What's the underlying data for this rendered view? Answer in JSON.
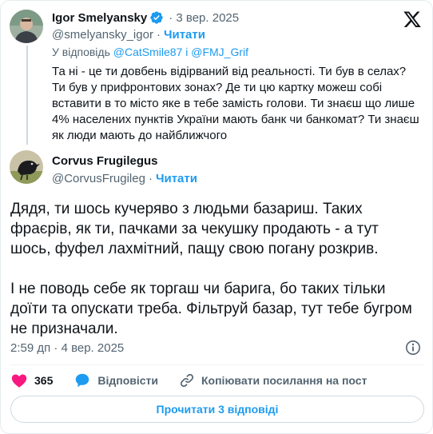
{
  "quoted": {
    "name": "Igor Smelyansky",
    "date": "· 3 вер. 2025",
    "handle": "@smelyansky_igor",
    "separator": "·",
    "follow_label": "Читати",
    "reply_prefix": "У відповідь",
    "reply_mentions": "@CatSmile87 і @FMJ_Grif",
    "text": "Та ні - це ти довбень відірваний від реальності. Ти був в селах? Ти був у прифронтових зонах? Де ти цю картку можеш собі вставити в то місто яке в тебе замість голови. Ти знаєш що лише 4% населених пунктів України мають банк чи банкомат? Ти знаєш як люди мають до найближчого"
  },
  "main": {
    "name": "Corvus Frugilegus",
    "handle": "@CorvusFrugileg",
    "separator": "·",
    "follow_label": "Читати",
    "text": "Дядя, ти шось кучеряво з людьми базариш. Таких фраєрів, як ти, пачками за чекушку продають - а тут шось, фуфел лахмітний, пащу свою погану розкрив.\n\nІ не поводь себе як торгаш чи барига, бо таких тільки доїти та опускати треба. Фільтруй базар, тут тебе бугром не призначали.",
    "timestamp": "2:59 дп · 4 вер. 2025"
  },
  "actions": {
    "likes": "365",
    "reply_label": "Відповісти",
    "copy_label": "Копіювати посилання на пост"
  },
  "read_replies_label": "Прочитати 3 відповіді",
  "icons": {
    "brand": "x-logo-icon",
    "verified": "verified-badge-icon",
    "like": "heart-icon",
    "reply": "speech-bubble-icon",
    "copy": "link-icon",
    "info": "info-icon"
  },
  "colors": {
    "accent": "#1d9bf0",
    "like": "#f91880",
    "text": "#0f1419",
    "muted": "#536471"
  }
}
